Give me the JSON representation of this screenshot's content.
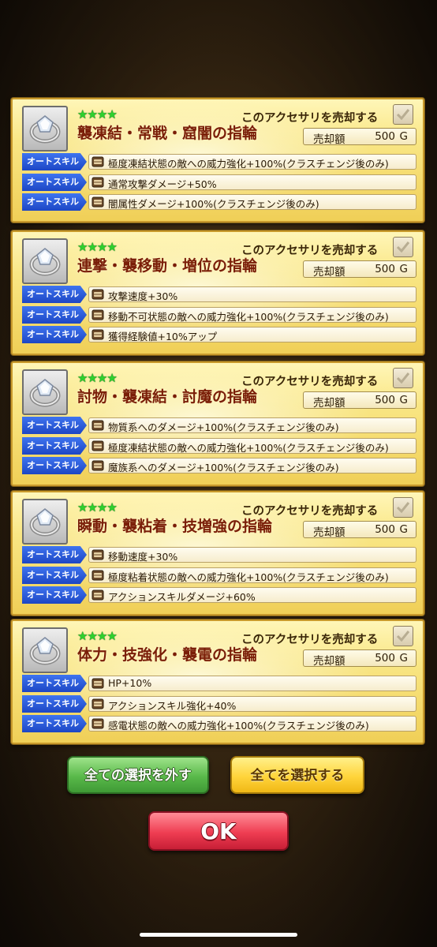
{
  "sell_label": "このアクセサリを売却する",
  "price_label": "売却額",
  "auto_skill_label": "オートスキル",
  "accessories": [
    {
      "stars": "★★★★",
      "name": "襲凍結・常戦・窟闇の指輪",
      "price": "500",
      "currency": "G",
      "skills": [
        "極度凍結状態の敵への威力強化+100%(クラスチェンジ後のみ)",
        "通常攻撃ダメージ+50%",
        "闇属性ダメージ+100%(クラスチェンジ後のみ)"
      ]
    },
    {
      "stars": "★★★★",
      "name": "連撃・襲移動・増位の指輪",
      "price": "500",
      "currency": "G",
      "skills": [
        "攻撃速度+30%",
        "移動不可状態の敵への威力強化+100%(クラスチェンジ後のみ)",
        "獲得経験値+10%アップ"
      ]
    },
    {
      "stars": "★★★★",
      "name": "討物・襲凍結・討魔の指輪",
      "price": "500",
      "currency": "G",
      "skills": [
        "物質系へのダメージ+100%(クラスチェンジ後のみ)",
        "極度凍結状態の敵への威力強化+100%(クラスチェンジ後のみ)",
        "魔族系へのダメージ+100%(クラスチェンジ後のみ)"
      ]
    },
    {
      "stars": "★★★★",
      "name": "瞬動・襲粘着・技増強の指輪",
      "price": "500",
      "currency": "G",
      "skills": [
        "移動速度+30%",
        "極度粘着状態の敵への威力強化+100%(クラスチェンジ後のみ)",
        "アクションスキルダメージ+60%"
      ]
    },
    {
      "stars": "★★★★",
      "name": "体力・技強化・襲電の指輪",
      "price": "500",
      "currency": "G",
      "skills": [
        "HP+10%",
        "アクションスキル強化+40%",
        "感電状態の敵への威力強化+100%(クラスチェンジ後のみ)"
      ]
    }
  ],
  "buttons": {
    "deselect_all": "全ての選択を外す",
    "select_all": "全てを選択する",
    "ok": "OK"
  },
  "icons": {
    "ring": "ring-icon",
    "checkbox": "checkbox-checked-icon",
    "skill": "skill-crest-icon"
  },
  "colors": {
    "card_bg": "#f9e684",
    "item_name": "#7a1e08",
    "stars": "#2ed12e",
    "skill_tag": "#1d46c4",
    "deselect_button": "#59b94a",
    "select_all_button": "#ffd43b",
    "ok_button": "#ef3d52"
  }
}
